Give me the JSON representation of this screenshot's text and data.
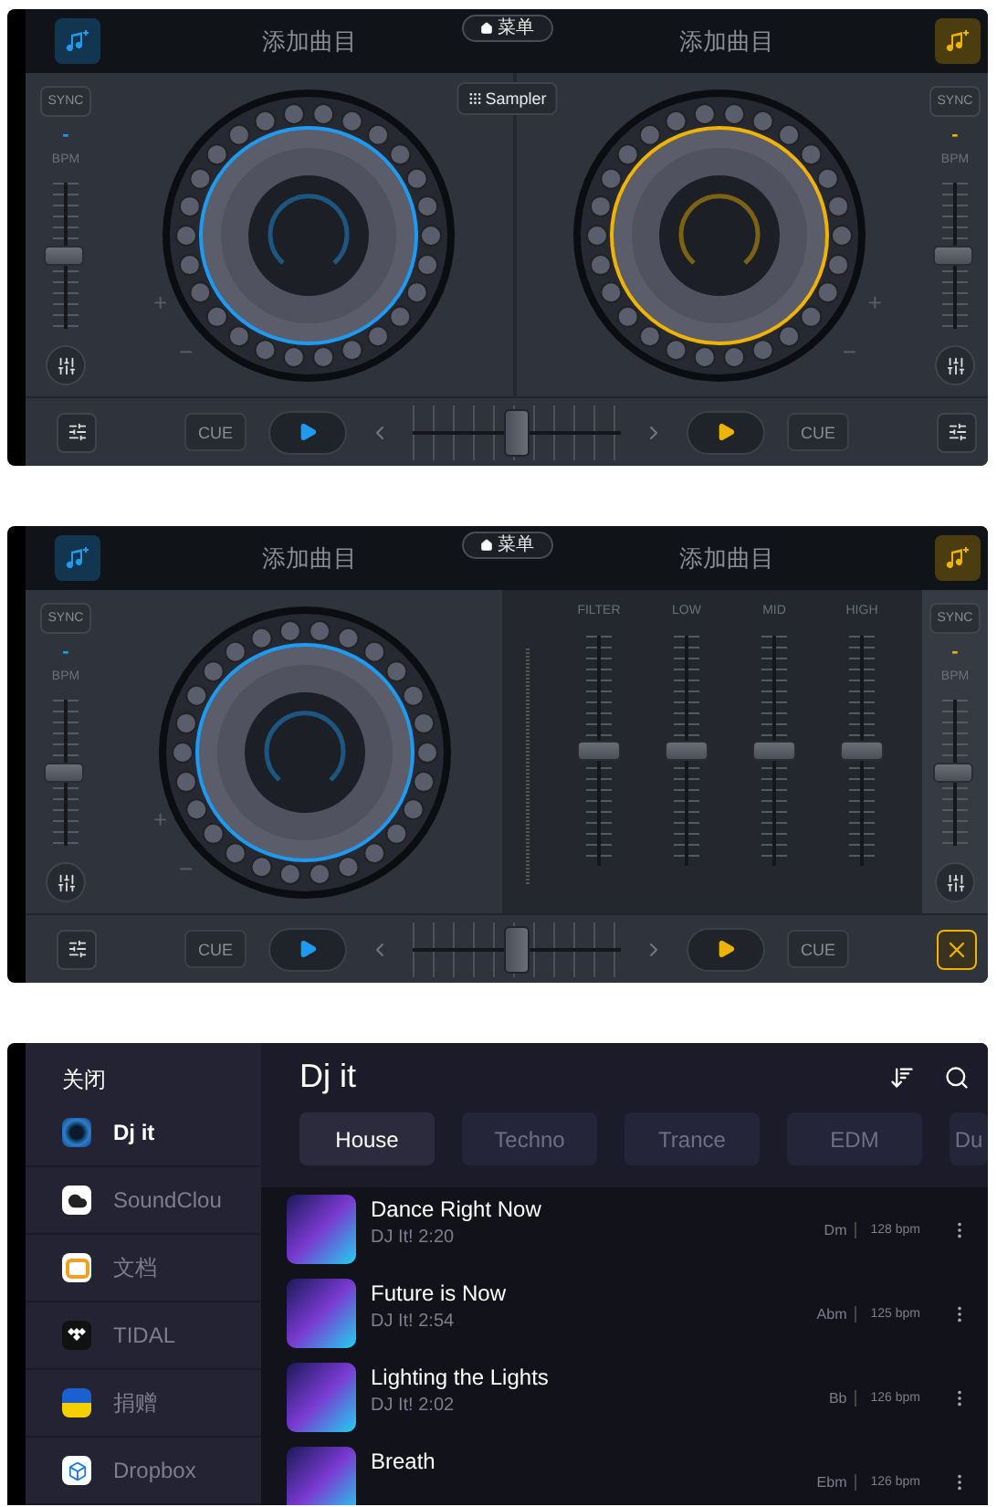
{
  "deck_screens": [
    {
      "kind": "two_decks",
      "left_title": "添加曲目",
      "right_title": "添加曲目",
      "menu": "菜单",
      "sampler": "Sampler",
      "corner_button": {
        "kind": "settings"
      },
      "crossfader": {
        "level": 0.5
      },
      "decks": [
        {
          "color": "#1e9bf0",
          "sync": "SYNC",
          "bpm": "-",
          "bpm_label": "BPM",
          "pitch": {
            "level": 0.5
          },
          "plus": "+",
          "minus": "−",
          "cue": "CUE"
        },
        {
          "color": "#f0b400",
          "sync": "SYNC",
          "bpm": "-",
          "bpm_label": "BPM",
          "pitch": {
            "level": 0.5
          },
          "plus": "+",
          "minus": "−",
          "cue": "CUE"
        }
      ]
    },
    {
      "kind": "eq_mixer",
      "left_title": "添加曲目",
      "right_title": "添加曲目",
      "menu": "菜单",
      "corner_button": {
        "kind": "close"
      },
      "crossfader": {
        "level": 0.5
      },
      "decks": [
        {
          "color": "#1e9bf0",
          "sync": "SYNC",
          "bpm": "-",
          "bpm_label": "BPM",
          "pitch": {
            "level": 0.5
          },
          "plus": "+",
          "minus": "−",
          "cue": "CUE"
        },
        {
          "color": "#f0b400",
          "sync": "SYNC",
          "bpm": "-",
          "bpm_label": "BPM",
          "pitch": {
            "level": 0.5
          },
          "cue": "CUE"
        }
      ],
      "mixer": [
        {
          "label": "FILTER",
          "level": 0.5
        },
        {
          "label": "LOW",
          "level": 0.5
        },
        {
          "label": "MID",
          "level": 0.5
        },
        {
          "label": "HIGH",
          "level": 0.5
        }
      ]
    }
  ],
  "library": {
    "close": "关闭",
    "title": "Dj it",
    "sources": [
      {
        "kind": "djit",
        "name": "Dj it",
        "selected": true
      },
      {
        "kind": "soundcloud",
        "name": "SoundClou",
        "selected": false
      },
      {
        "kind": "docs",
        "name": "文档",
        "selected": false
      },
      {
        "kind": "tidal",
        "name": "TIDAL",
        "selected": false
      },
      {
        "kind": "donate",
        "name": "捐赠",
        "selected": false
      },
      {
        "kind": "dropbox",
        "name": "Dropbox",
        "selected": false
      }
    ],
    "genres": [
      {
        "label": "House",
        "selected": true
      },
      {
        "label": "Techno",
        "selected": false
      },
      {
        "label": "Trance",
        "selected": false
      },
      {
        "label": "EDM",
        "selected": false
      },
      {
        "label": "Du",
        "selected": false
      }
    ],
    "tracks": [
      {
        "title": "Dance Right Now",
        "subtitle": "DJ It! 2:20",
        "key": "Dm",
        "bpm": "128 bpm"
      },
      {
        "title": "Future is Now",
        "subtitle": "DJ It! 2:54",
        "key": "Abm",
        "bpm": "125 bpm"
      },
      {
        "title": "Lighting the Lights",
        "subtitle": "DJ It! 2:02",
        "key": "Bb",
        "bpm": "126 bpm"
      },
      {
        "title": "Breath",
        "key": "Ebm",
        "bpm": "126 bpm"
      }
    ]
  }
}
